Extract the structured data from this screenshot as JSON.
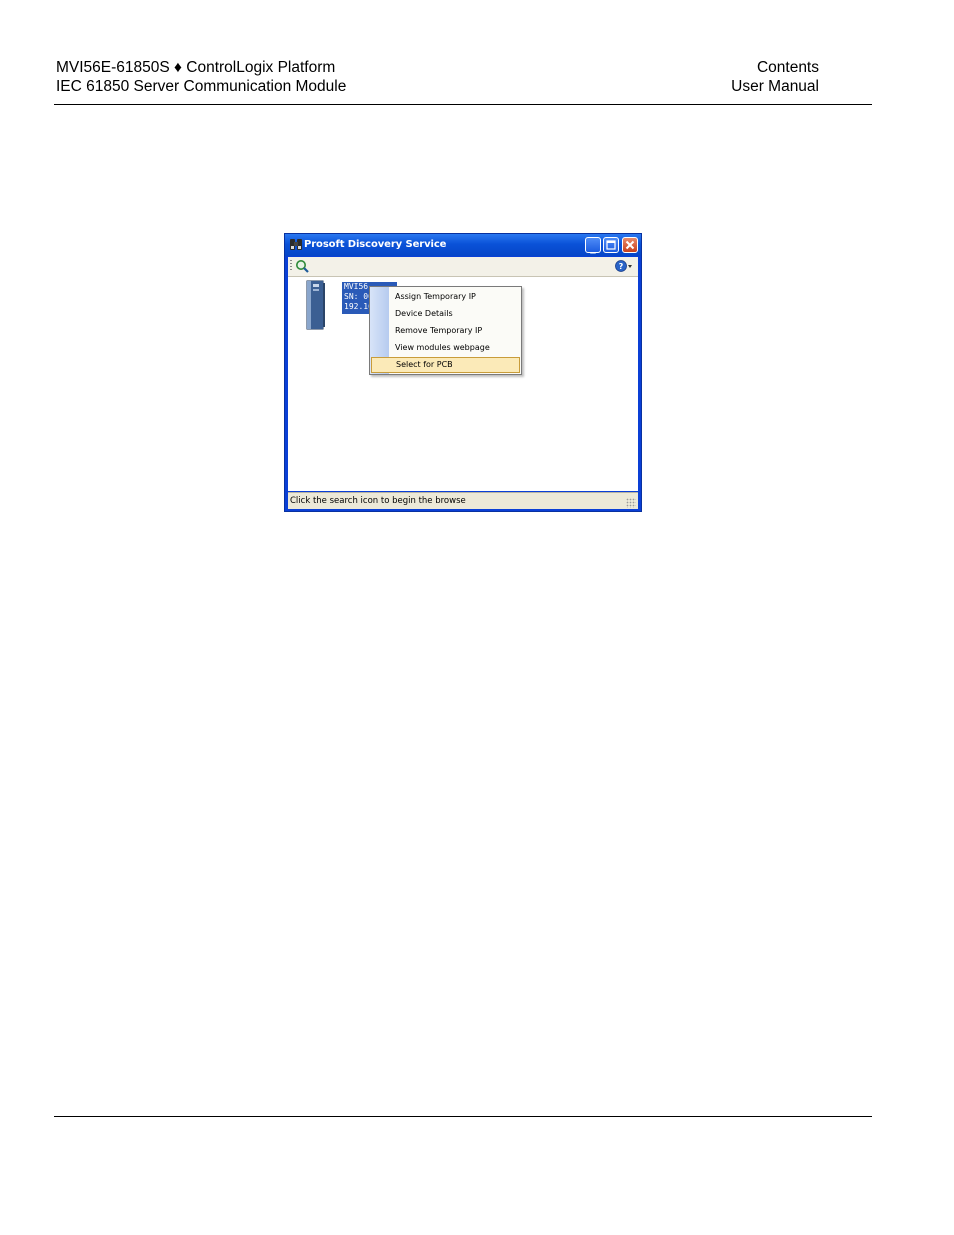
{
  "header": {
    "left_line1": "MVI56E-61850S ♦ ControlLogix Platform",
    "left_line2": "IEC 61850 Server Communication Module",
    "right_line1": "Contents",
    "right_line2": "User Manual"
  },
  "window": {
    "title": "Prosoft Discovery Service",
    "status_text": "Click the search icon to begin the browse",
    "device": {
      "line1": "MVI56",
      "line2": "SN: 00",
      "line3": "192.16"
    },
    "context_menu": {
      "items": [
        "Assign Temporary IP",
        "Device Details",
        "Remove Temporary IP",
        "View modules webpage",
        "Select for PCB"
      ],
      "highlighted_index": 4
    },
    "colors": {
      "titlebar": "#0a52d8",
      "selection": "#2a5ab8",
      "menu_highlight": "#fbeab8"
    }
  }
}
